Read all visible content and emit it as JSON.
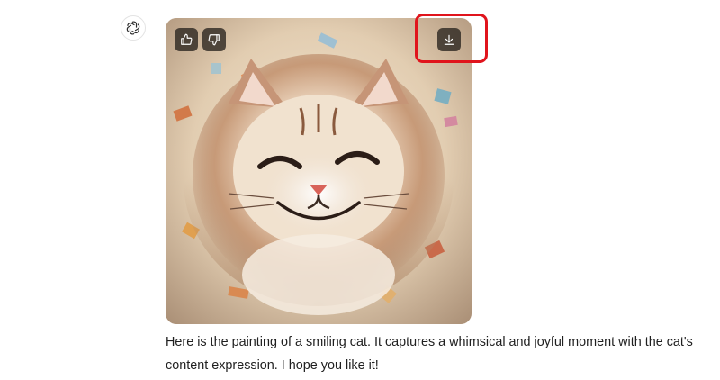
{
  "assistant": {
    "avatar_icon": "openai-logo-icon"
  },
  "image": {
    "subject": "painting of a smiling cat",
    "actions": {
      "like_icon": "thumbs-up-icon",
      "dislike_icon": "thumbs-down-icon",
      "download_icon": "download-icon"
    }
  },
  "annotation": {
    "highlight_color": "#e0141c"
  },
  "message": {
    "text": "Here is the painting of a smiling cat. It captures a whimsical and joyful moment with the cat's content expression. I hope you like it!"
  }
}
